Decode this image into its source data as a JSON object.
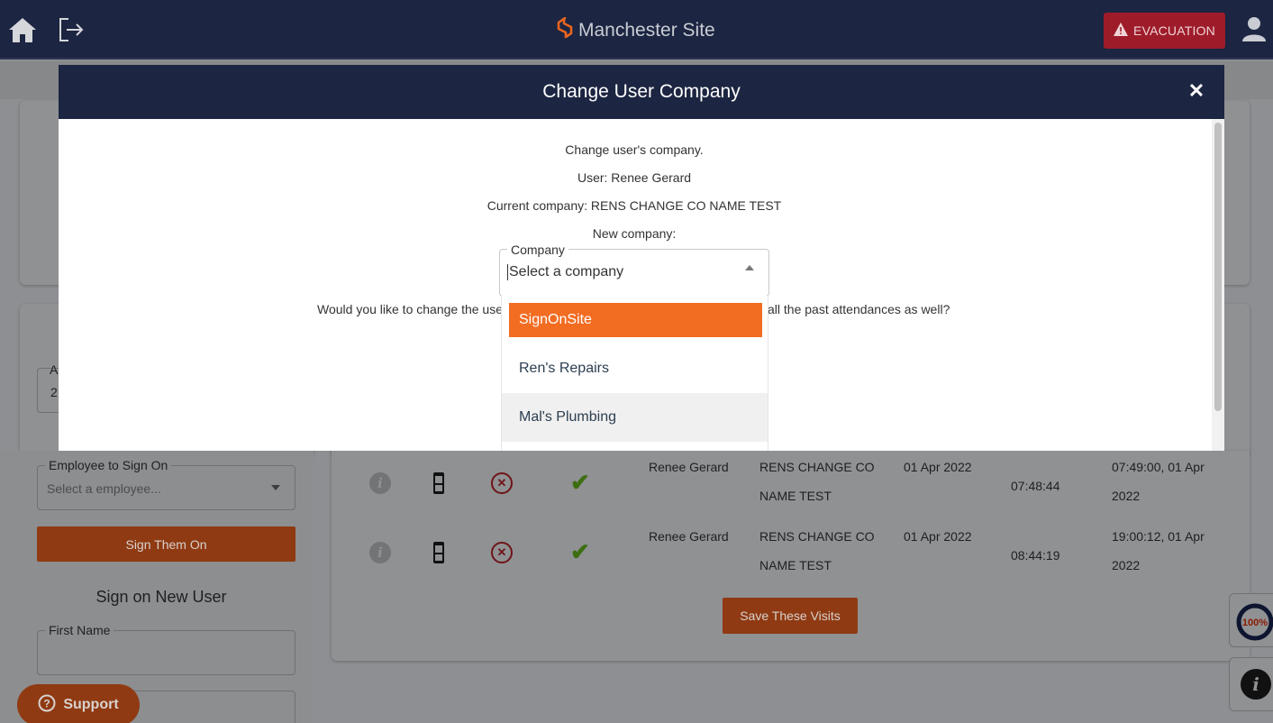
{
  "topnav": {
    "site_name": "Manchester Site",
    "evacuation_label": "EVACUATION"
  },
  "background": {
    "left_panel": {
      "employee_field_label": "Employee to Sign On",
      "employee_field_placeholder": "Select a employee...",
      "sign_on_button": "Sign Them On",
      "new_user_heading": "Sign on New User",
      "first_name_label": "First Name",
      "partial_field_letter": "A",
      "partial_field_value": "2"
    },
    "visits": [
      {
        "name": "Renee Gerard",
        "company_line1": "RENS CHANGE CO",
        "company_line2": "NAME TEST",
        "date": "01 Apr 2022",
        "time_in": "07:48:44",
        "out_line1": "07:49:00, 01 Apr",
        "out_line2": "2022"
      },
      {
        "name": "Renee Gerard",
        "company_line1": "RENS CHANGE CO",
        "company_line2": "NAME TEST",
        "date": "01 Apr 2022",
        "time_in": "08:44:19",
        "out_line1": "19:00:12, 01 Apr",
        "out_line2": "2022"
      }
    ],
    "save_visits_button": "Save These Visits",
    "support_button": "Support",
    "progress_badge": "100%"
  },
  "modal": {
    "title": "Change User Company",
    "line_intro": "Change user's company.",
    "line_user": "User: Renee Gerard",
    "line_current": "Current company: RENS CHANGE CO NAME TEST",
    "line_new": "New company:",
    "question_left": "Would you like to change the use",
    "question_right": "all the past attendances as well?",
    "company_select": {
      "label": "Company",
      "placeholder": "Select a company",
      "options": [
        "SignOnSite",
        "Ren's Repairs",
        "Mal's Plumbing"
      ],
      "highlighted_option": "SignOnSite"
    }
  },
  "colors": {
    "navy": "#1c2541",
    "brand_orange": "#f26c22",
    "evacuation_red": "#9e1c2a"
  }
}
